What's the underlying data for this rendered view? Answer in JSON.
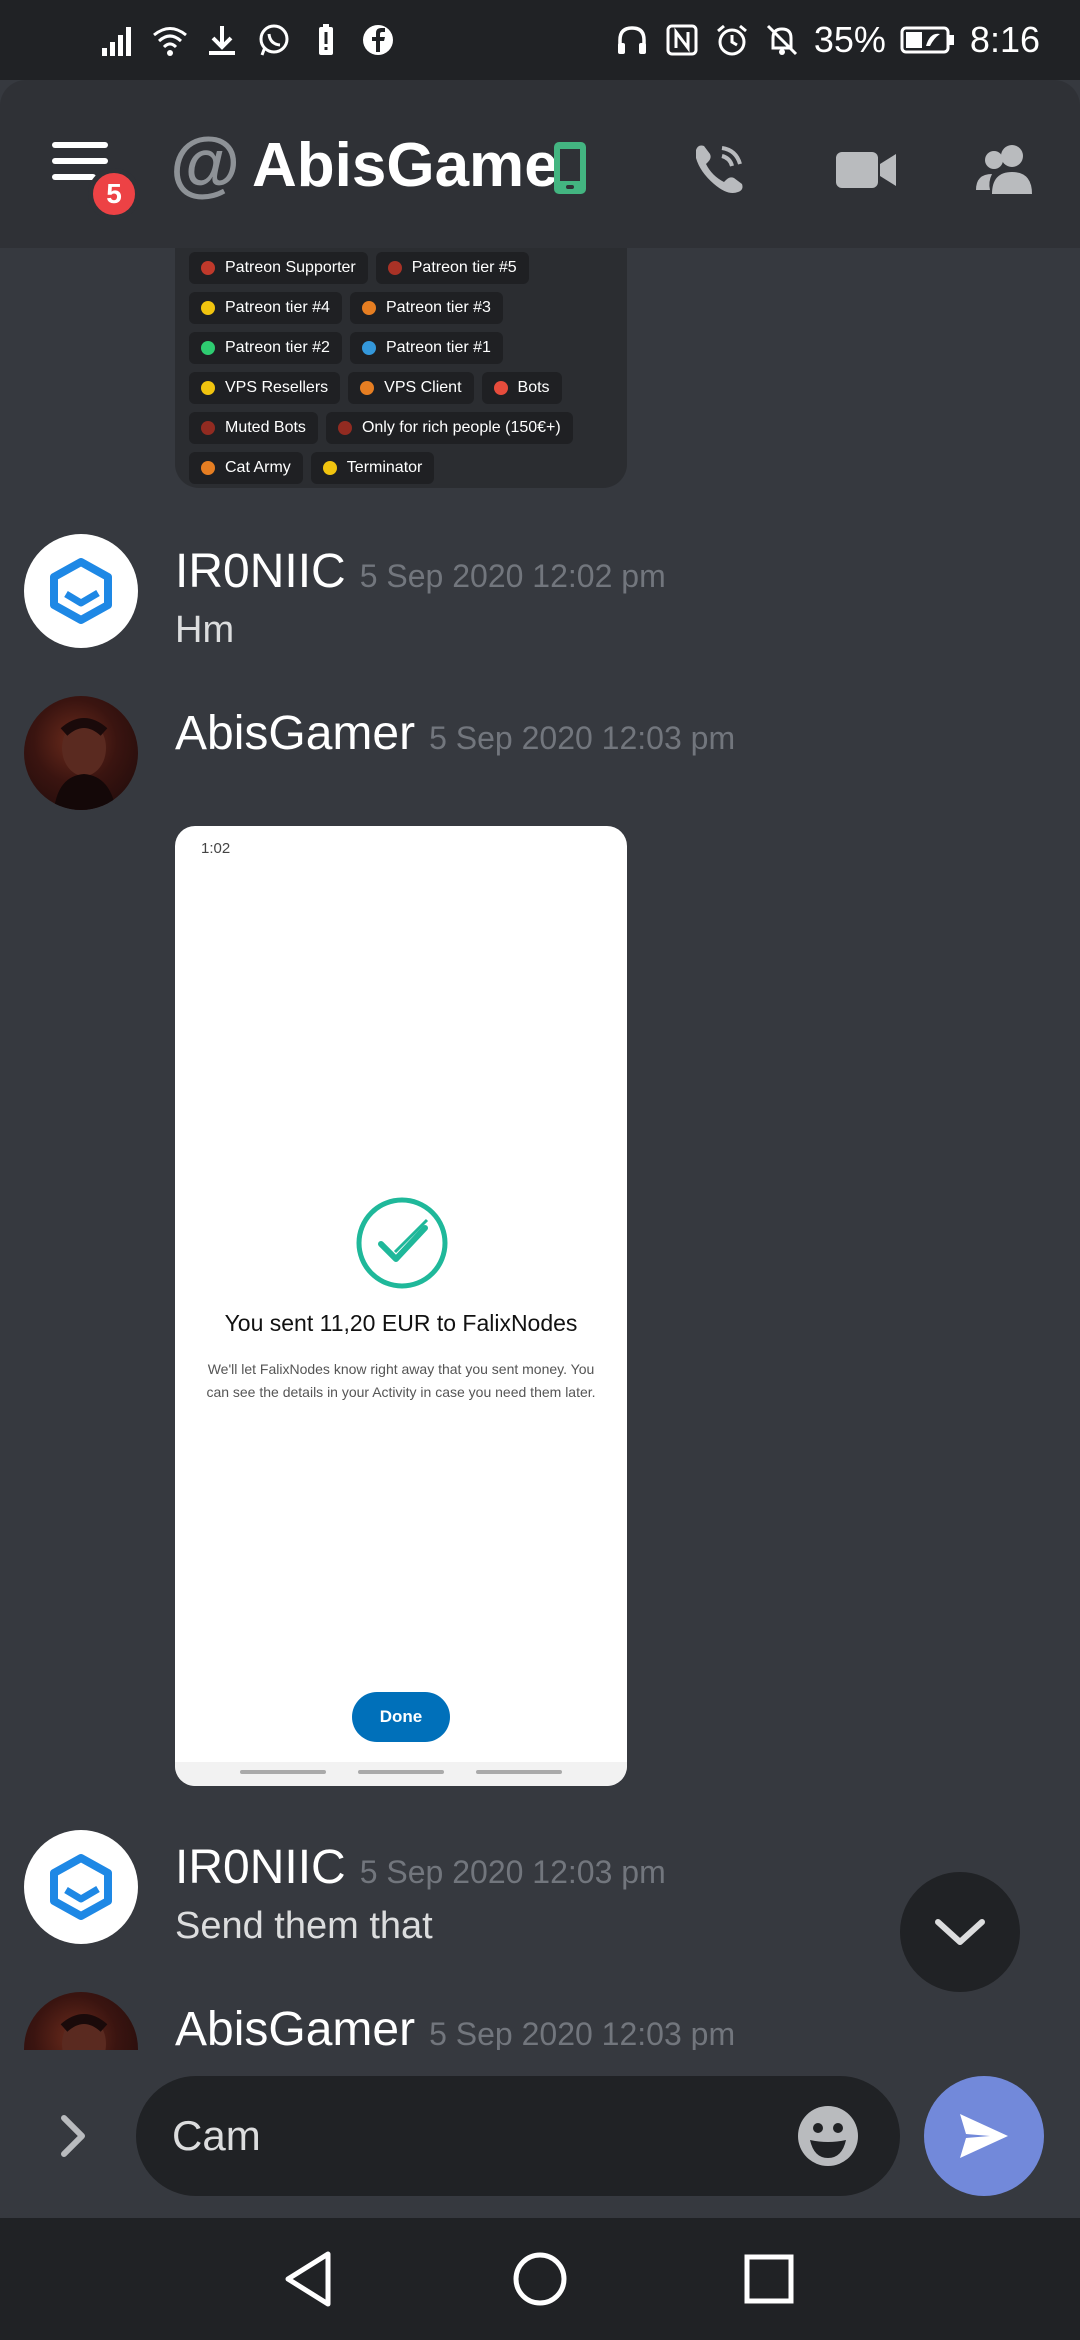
{
  "status_bar": {
    "battery": "35%",
    "time": "8:16"
  },
  "header": {
    "unread_badge": "5",
    "at_symbol": "@",
    "dm_name": "AbisGamer"
  },
  "roles": [
    [
      {
        "label": "Patreon Supporter",
        "color": "#c0392b"
      },
      {
        "label": "Patreon tier #5",
        "color": "#a93226"
      }
    ],
    [
      {
        "label": "Patreon tier #4",
        "color": "#f1c40f"
      },
      {
        "label": "Patreon tier #3",
        "color": "#e67e22"
      }
    ],
    [
      {
        "label": "Patreon tier #2",
        "color": "#2ecc71"
      },
      {
        "label": "Patreon tier #1",
        "color": "#3498db"
      }
    ],
    [
      {
        "label": "VPS Resellers",
        "color": "#f1c40f"
      },
      {
        "label": "VPS Client",
        "color": "#e67e22"
      },
      {
        "label": "Bots",
        "color": "#e74c3c"
      }
    ],
    [
      {
        "label": "Muted Bots",
        "color": "#922b21"
      },
      {
        "label": "Only for rich people (150€+)",
        "color": "#922b21"
      }
    ],
    [
      {
        "label": "Cat Army",
        "color": "#e67e22"
      },
      {
        "label": "Terminator",
        "color": "#f1c40f"
      }
    ]
  ],
  "messages": [
    {
      "author": "IR0NIIC",
      "timestamp": "5 Sep 2020 12:02 pm",
      "text": "Hm"
    },
    {
      "author": "AbisGamer",
      "timestamp": "5 Sep 2020 12:03 pm",
      "text": ""
    },
    {
      "author": "IR0NIIC",
      "timestamp": "5 Sep 2020 12:03 pm",
      "text": "Send them that"
    },
    {
      "author": "AbisGamer",
      "timestamp": "5 Sep 2020 12:03 pm",
      "text": ""
    }
  ],
  "attachment": {
    "status_time": "1:02",
    "title": "You sent 11,20 EUR to FalixNodes",
    "body": "We'll let FalixNodes know right away that you sent money. You can see the details in your Activity in case you need them later.",
    "button": "Done"
  },
  "composer": {
    "value": "Cam"
  },
  "colors": {
    "background": "#36393f",
    "header": "#2f3136",
    "accent": "#7289da",
    "badge": "#ed4245",
    "online_phone": "#43b581"
  }
}
